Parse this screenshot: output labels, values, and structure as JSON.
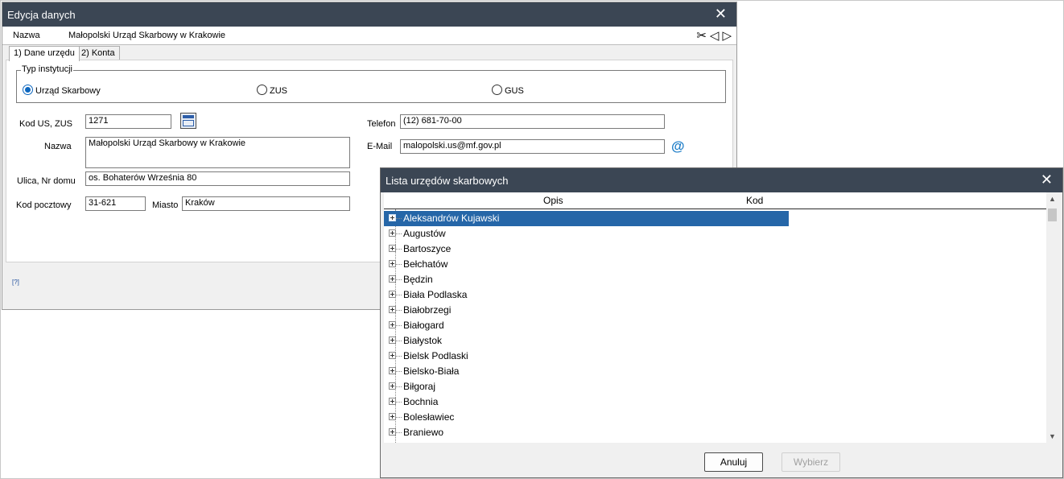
{
  "edit_window": {
    "title": "Edycja danych",
    "close_icon": "✕",
    "nazwa_label": "Nazwa",
    "nazwa_value": "Małopolski Urząd Skarbowy w Krakowie",
    "nav_icons": [
      "scissors-icon",
      "prev-icon",
      "next-icon"
    ],
    "tabs": [
      "1) Dane urzędu",
      "2) Konta"
    ],
    "institution_group": {
      "legend": "Typ instytucji",
      "options": [
        {
          "label": "Urząd Skarbowy",
          "selected": true
        },
        {
          "label": "ZUS",
          "selected": false
        },
        {
          "label": "GUS",
          "selected": false
        }
      ]
    },
    "fields": {
      "kod_label": "Kod US, ZUS",
      "kod_value": "1271",
      "nazwa_label": "Nazwa",
      "nazwa_value": "Małopolski Urząd Skarbowy w Krakowie",
      "ulica_label": "Ulica, Nr domu",
      "ulica_value": "os. Bohaterów Września  80",
      "kod_pocztowy_label": "Kod pocztowy",
      "kod_pocztowy_value": "31-621",
      "miasto_label": "Miasto",
      "miasto_value": "Kraków",
      "telefon_label": "Telefon",
      "telefon_value": "(12) 681-70-00",
      "email_label": "E-Mail",
      "email_value": "malopolski.us@mf.gov.pl"
    },
    "help_marker": "[?]"
  },
  "list_window": {
    "title": "Lista urzędów skarbowych",
    "close_icon": "✕",
    "columns": [
      "Opis",
      "Kod"
    ],
    "items": [
      "Aleksandrów Kujawski",
      "Augustów",
      "Bartoszyce",
      "Bełchatów",
      "Będzin",
      "Biała Podlaska",
      "Białobrzegi",
      "Białogard",
      "Białystok",
      "Bielsk Podlaski",
      "Bielsko-Biała",
      "Biłgoraj",
      "Bochnia",
      "Bolesławiec",
      "Braniewo"
    ],
    "selected_index": 0,
    "buttons": {
      "cancel": "Anuluj",
      "select": "Wybierz"
    }
  },
  "colors": {
    "titlebar": "#3b4654",
    "selection": "#2566a8",
    "radio_accent": "#0d67bf",
    "at_icon": "#1b7cc7"
  }
}
